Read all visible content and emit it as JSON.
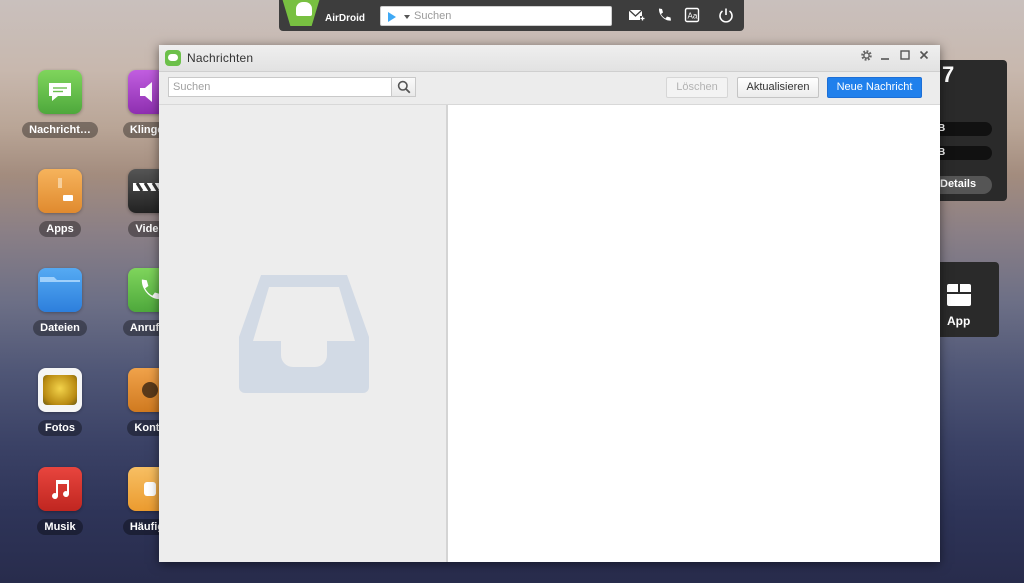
{
  "topbar": {
    "brand": "AirDroid",
    "search_placeholder": "Suchen",
    "icons": [
      "play-store-icon",
      "mail-add-icon",
      "phone-icon",
      "font-icon",
      "power-icon"
    ]
  },
  "desktop": {
    "icons": [
      {
        "label": "Nachricht…",
        "icon": "messages-icon",
        "color": "#5cb85c"
      },
      {
        "label": "Klingelt",
        "icon": "ringtone-icon",
        "color": "#a63fc0"
      },
      {
        "label": "Apps",
        "icon": "apps-box-icon",
        "color": "#e8963a"
      },
      {
        "label": "Videc",
        "icon": "video-clapper-icon",
        "color": "#333333"
      },
      {
        "label": "Dateien",
        "icon": "folder-icon",
        "color": "#3a8ee6"
      },
      {
        "label": "Anrufpr",
        "icon": "call-log-icon",
        "color": "#5cb85c"
      },
      {
        "label": "Fotos",
        "icon": "photos-icon",
        "color": "#d9a21b"
      },
      {
        "label": "Konta",
        "icon": "contacts-icon",
        "color": "#e08a2e"
      },
      {
        "label": "Musik",
        "icon": "music-icon",
        "color": "#d9302b"
      },
      {
        "label": "Häufige",
        "icon": "frequent-icon",
        "color": "#f1a53a"
      }
    ]
  },
  "right_widget": {
    "number": "7",
    "bar1": "B",
    "bar2": "B",
    "details": "Details",
    "app_label": "App"
  },
  "window": {
    "title": "Nachrichten",
    "controls": [
      "settings-icon",
      "minimize-icon",
      "maximize-icon",
      "close-icon"
    ],
    "search_placeholder": "Suchen",
    "buttons": {
      "delete": "Löschen",
      "refresh": "Aktualisieren",
      "new_message": "Neue Nachricht"
    },
    "accent": "#2080ec"
  }
}
